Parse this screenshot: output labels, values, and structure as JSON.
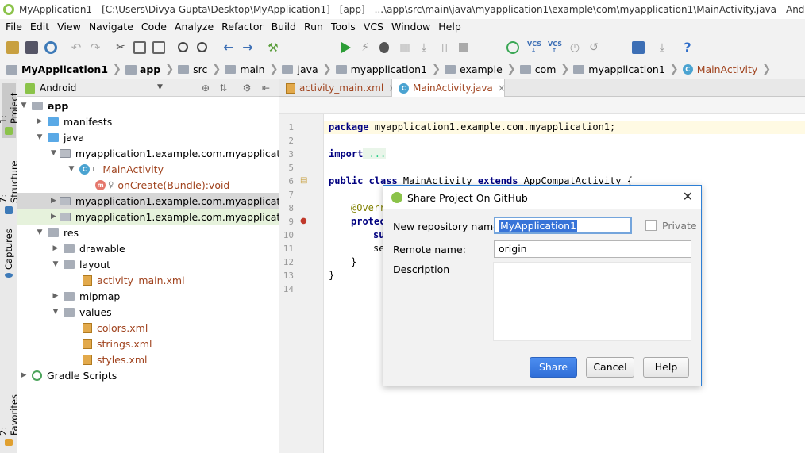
{
  "window": {
    "title": "MyApplication1 - [C:\\Users\\Divya Gupta\\Desktop\\MyApplication1] - [app] - ...\\app\\src\\main\\java\\myapplication1\\example\\com\\myapplication1\\MainActivity.java - Android Studio 3.0.1"
  },
  "menu": [
    "File",
    "Edit",
    "View",
    "Navigate",
    "Code",
    "Analyze",
    "Refactor",
    "Build",
    "Run",
    "Tools",
    "VCS",
    "Window",
    "Help"
  ],
  "toolbar": {
    "run_config": "app",
    "vcs_label": "VCS"
  },
  "breadcrumbs": [
    "MyApplication1",
    "app",
    "src",
    "main",
    "java",
    "myapplication1",
    "example",
    "com",
    "myapplication1",
    "MainActivity"
  ],
  "side_tabs": [
    "1: Project",
    "7: Structure",
    "Captures",
    "2: Favorites"
  ],
  "project_panel": {
    "view_mode": "Android",
    "tree": [
      {
        "label": "app"
      },
      {
        "label": "manifests"
      },
      {
        "label": "java"
      },
      {
        "label": "myapplication1.example.com.myapplication1"
      },
      {
        "label": "MainActivity"
      },
      {
        "label": "onCreate(Bundle):void"
      },
      {
        "label": "myapplication1.example.com.myapplication1 ("
      },
      {
        "label": "myapplication1.example.com.myapplication1 ("
      },
      {
        "label": "res"
      },
      {
        "label": "drawable"
      },
      {
        "label": "layout"
      },
      {
        "label": "activity_main.xml"
      },
      {
        "label": "mipmap"
      },
      {
        "label": "values"
      },
      {
        "label": "colors.xml"
      },
      {
        "label": "strings.xml"
      },
      {
        "label": "styles.xml"
      },
      {
        "label": "Gradle Scripts"
      }
    ]
  },
  "editor": {
    "tabs": [
      {
        "label": "activity_main.xml",
        "close": "×"
      },
      {
        "label": "MainActivity.java",
        "close": "×"
      }
    ],
    "line_numbers": [
      "1",
      "2",
      "3",
      "5",
      "6",
      "7",
      "8",
      "9",
      "10",
      "11",
      "12",
      "13",
      "14"
    ],
    "code_lines": {
      "l1_kw": "package",
      "l1_rest": " myapplication1.example.com.myapplication1;",
      "l3_kw": "import",
      "l3_fold": " ...",
      "l6_kw": "public class",
      "l6_name": " MainActivity ",
      "l6_kw2": "extends",
      "l6_rest": " AppCompatActivity {",
      "l8": "@Overr",
      "l9": "protec",
      "l10": "su",
      "l11": "se",
      "l12": "}",
      "l13": "}"
    }
  },
  "dialog": {
    "title": "Share Project On GitHub",
    "repo_label": "New repository name:",
    "repo_value": "MyApplication1",
    "private_label": "Private",
    "remote_label": "Remote name:",
    "remote_value": "origin",
    "description_label": "Description",
    "share_btn": "Share",
    "cancel_btn": "Cancel",
    "help_btn": "Help",
    "close_glyph": "✕"
  }
}
